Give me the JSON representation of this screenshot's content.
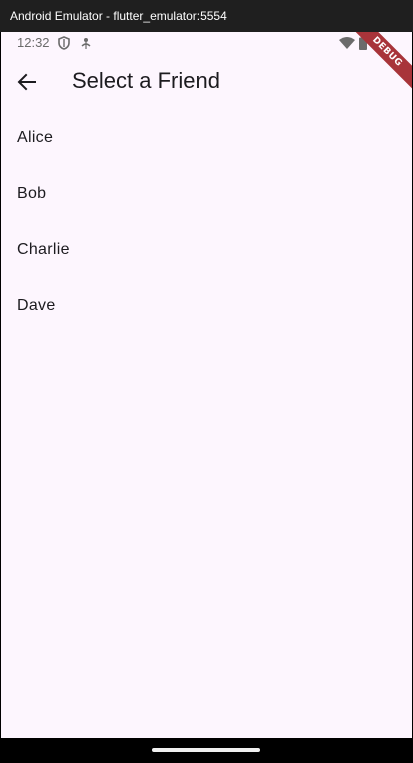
{
  "window": {
    "title": "Android Emulator - flutter_emulator:5554"
  },
  "status_bar": {
    "time": "12:32"
  },
  "debug_banner": "DEBUG",
  "app_bar": {
    "title": "Select a Friend"
  },
  "friends": [
    "Alice",
    "Bob",
    "Charlie",
    "Dave"
  ],
  "colors": {
    "background": "#fdf6fe",
    "text": "#1c1b1f",
    "debug": "#a8343a"
  }
}
